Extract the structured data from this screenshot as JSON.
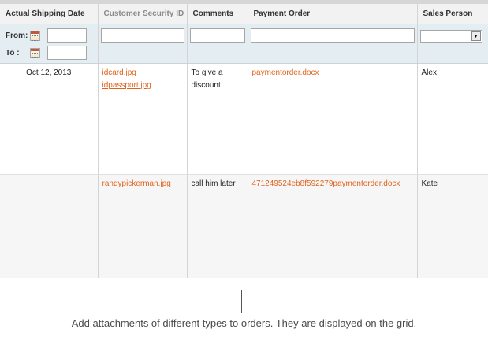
{
  "grid": {
    "headers": {
      "actual_shipping_date": "Actual Shipping Date",
      "customer_security_id": "Customer Security ID",
      "comments": "Comments",
      "payment_order": "Payment Order",
      "sales_person": "Sales Person"
    },
    "filters": {
      "from_label": "From:",
      "to_label": "To :",
      "from_value": "",
      "to_value": "",
      "customer_security_id_value": "",
      "comments_value": "",
      "payment_order_value": "",
      "sales_person_selected": ""
    },
    "rows": [
      {
        "actual_shipping_date": "Oct 12, 2013",
        "customer_security_ids": [
          "idcard.jpg",
          "idpassport.jpg"
        ],
        "comments": "To give a discount",
        "payment_order": "paymentorder.docx",
        "sales_person": "Alex"
      },
      {
        "actual_shipping_date": "",
        "customer_security_ids": [
          "randypickerman.jpg"
        ],
        "comments": "call him later",
        "payment_order": "471249524eb8f592279paymentorder.docx",
        "sales_person": "Kate"
      }
    ]
  },
  "caption": "Add attachments of different types to orders. They are displayed on the grid.",
  "colors": {
    "link": "#e0641e",
    "header_bg": "#f2f2f2",
    "filter_bg": "#e3edf2"
  }
}
